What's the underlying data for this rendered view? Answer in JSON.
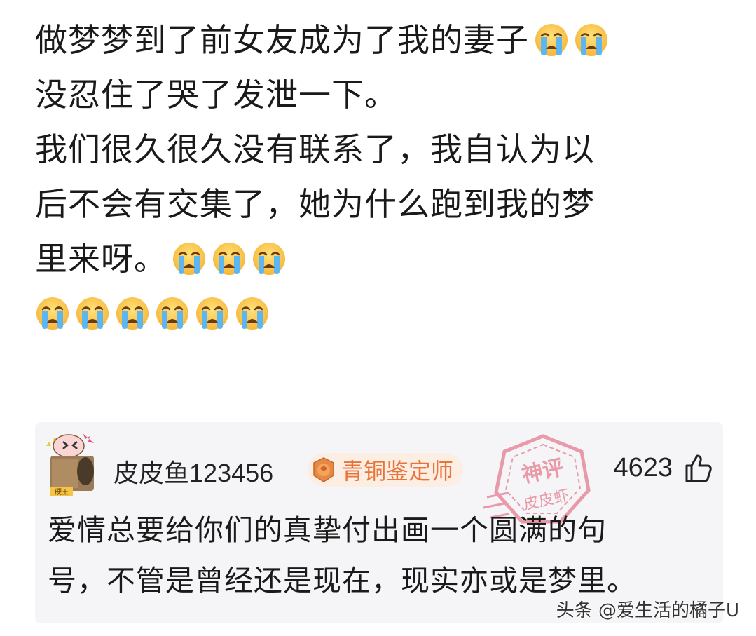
{
  "post": {
    "lines": [
      "做梦梦到了前女友成为了我的妻子",
      "没忍住了哭了发泄一下。",
      "我们很久很久没有联系了，我自认为以",
      "后不会有交集了，她为什么跑到我的梦",
      "里来呀。"
    ],
    "emoji_name": "loudly-crying-face-icon",
    "line1_emoji_count": 2,
    "line5_emoji_count": 3,
    "line6_emoji_count": 6
  },
  "comment": {
    "username": "皮皮鱼123456",
    "badge_label": "青铜鉴定师",
    "avatar_tag": "硬王",
    "likes": "4623",
    "stamp_top": "神评",
    "stamp_bottom": "皮皮虾",
    "text_lines": [
      "爱情总要给你们的真挚付出画一个圆满的句",
      "号，不管是曾经还是现在，现实亦或是梦里。"
    ]
  },
  "watermark": "头条 @爱生活的橘子U",
  "colors": {
    "badge_text": "#e8743a",
    "badge_bg": "#fdeee4",
    "stamp": "#e0506a",
    "card_bg": "#f5f5f7"
  }
}
